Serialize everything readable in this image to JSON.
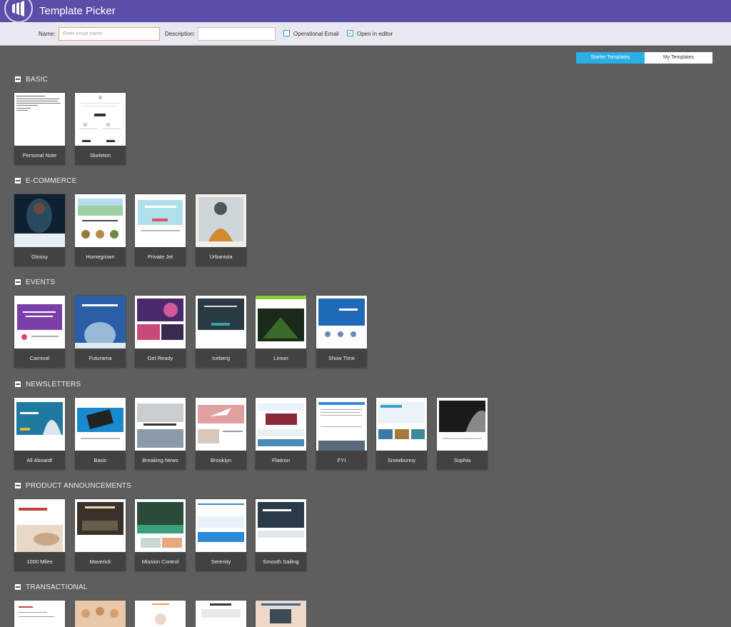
{
  "app": {
    "title": "Template Picker"
  },
  "toolbar": {
    "name_label": "Name:",
    "name_placeholder": "Enter email name",
    "name_value": "",
    "description_label": "Description:",
    "description_value": "",
    "operational_label": "Operational Email",
    "operational_checked": false,
    "open_editor_label": "Open in editor",
    "open_editor_checked": true
  },
  "tabs": {
    "starter": "Starter Templates",
    "mine": "My Templates",
    "active": "starter"
  },
  "colors": {
    "header": "#5a4fa8",
    "toolbar": "#e9e7ef",
    "canvas": "#5e5e5e",
    "accent": "#2ab0e4",
    "caption": "#2d2d2d"
  },
  "sections": [
    {
      "title": "BASIC",
      "templates": [
        {
          "name": "Personal Note",
          "style": "text"
        },
        {
          "name": "Skeleton",
          "style": "skeleton"
        }
      ]
    },
    {
      "title": "E-COMMERCE",
      "templates": [
        {
          "name": "Glossy",
          "style": "dark-photo"
        },
        {
          "name": "Homegrown",
          "style": "green-banner"
        },
        {
          "name": "Private Jet",
          "style": "collection"
        },
        {
          "name": "Urbanista",
          "style": "portrait"
        }
      ]
    },
    {
      "title": "EVENTS",
      "templates": [
        {
          "name": "Carnival",
          "style": "purple"
        },
        {
          "name": "Futurama",
          "style": "blue-dome"
        },
        {
          "name": "Get Ready",
          "style": "concert"
        },
        {
          "name": "Iceberg",
          "style": "dark-teal"
        },
        {
          "name": "Limon",
          "style": "lime"
        },
        {
          "name": "Show Time",
          "style": "blue-event"
        }
      ]
    },
    {
      "title": "NEWSLETTERS",
      "templates": [
        {
          "name": "All Aboard!",
          "style": "teal-person"
        },
        {
          "name": "Basic",
          "style": "phone"
        },
        {
          "name": "Breaking News",
          "style": "news"
        },
        {
          "name": "Brooklyn",
          "style": "plane"
        },
        {
          "name": "Flatiron",
          "style": "flatiron"
        },
        {
          "name": "FYI",
          "style": "fyi"
        },
        {
          "name": "Snowbunny",
          "style": "snow"
        },
        {
          "name": "Sophia",
          "style": "dark"
        }
      ]
    },
    {
      "title": "PRODUCT ANNOUNCEMENTS",
      "templates": [
        {
          "name": "1000 Miles",
          "style": "shoes"
        },
        {
          "name": "Maverick",
          "style": "maverick"
        },
        {
          "name": "Mission Control",
          "style": "mission"
        },
        {
          "name": "Serenity",
          "style": "serenity"
        },
        {
          "name": "Smooth Sailing",
          "style": "sailing"
        }
      ]
    },
    {
      "title": "TRANSACTIONAL",
      "templates": [
        {
          "name": "",
          "style": "t1"
        },
        {
          "name": "",
          "style": "t2"
        },
        {
          "name": "",
          "style": "t3"
        },
        {
          "name": "",
          "style": "t4"
        },
        {
          "name": "",
          "style": "t5"
        }
      ]
    }
  ]
}
